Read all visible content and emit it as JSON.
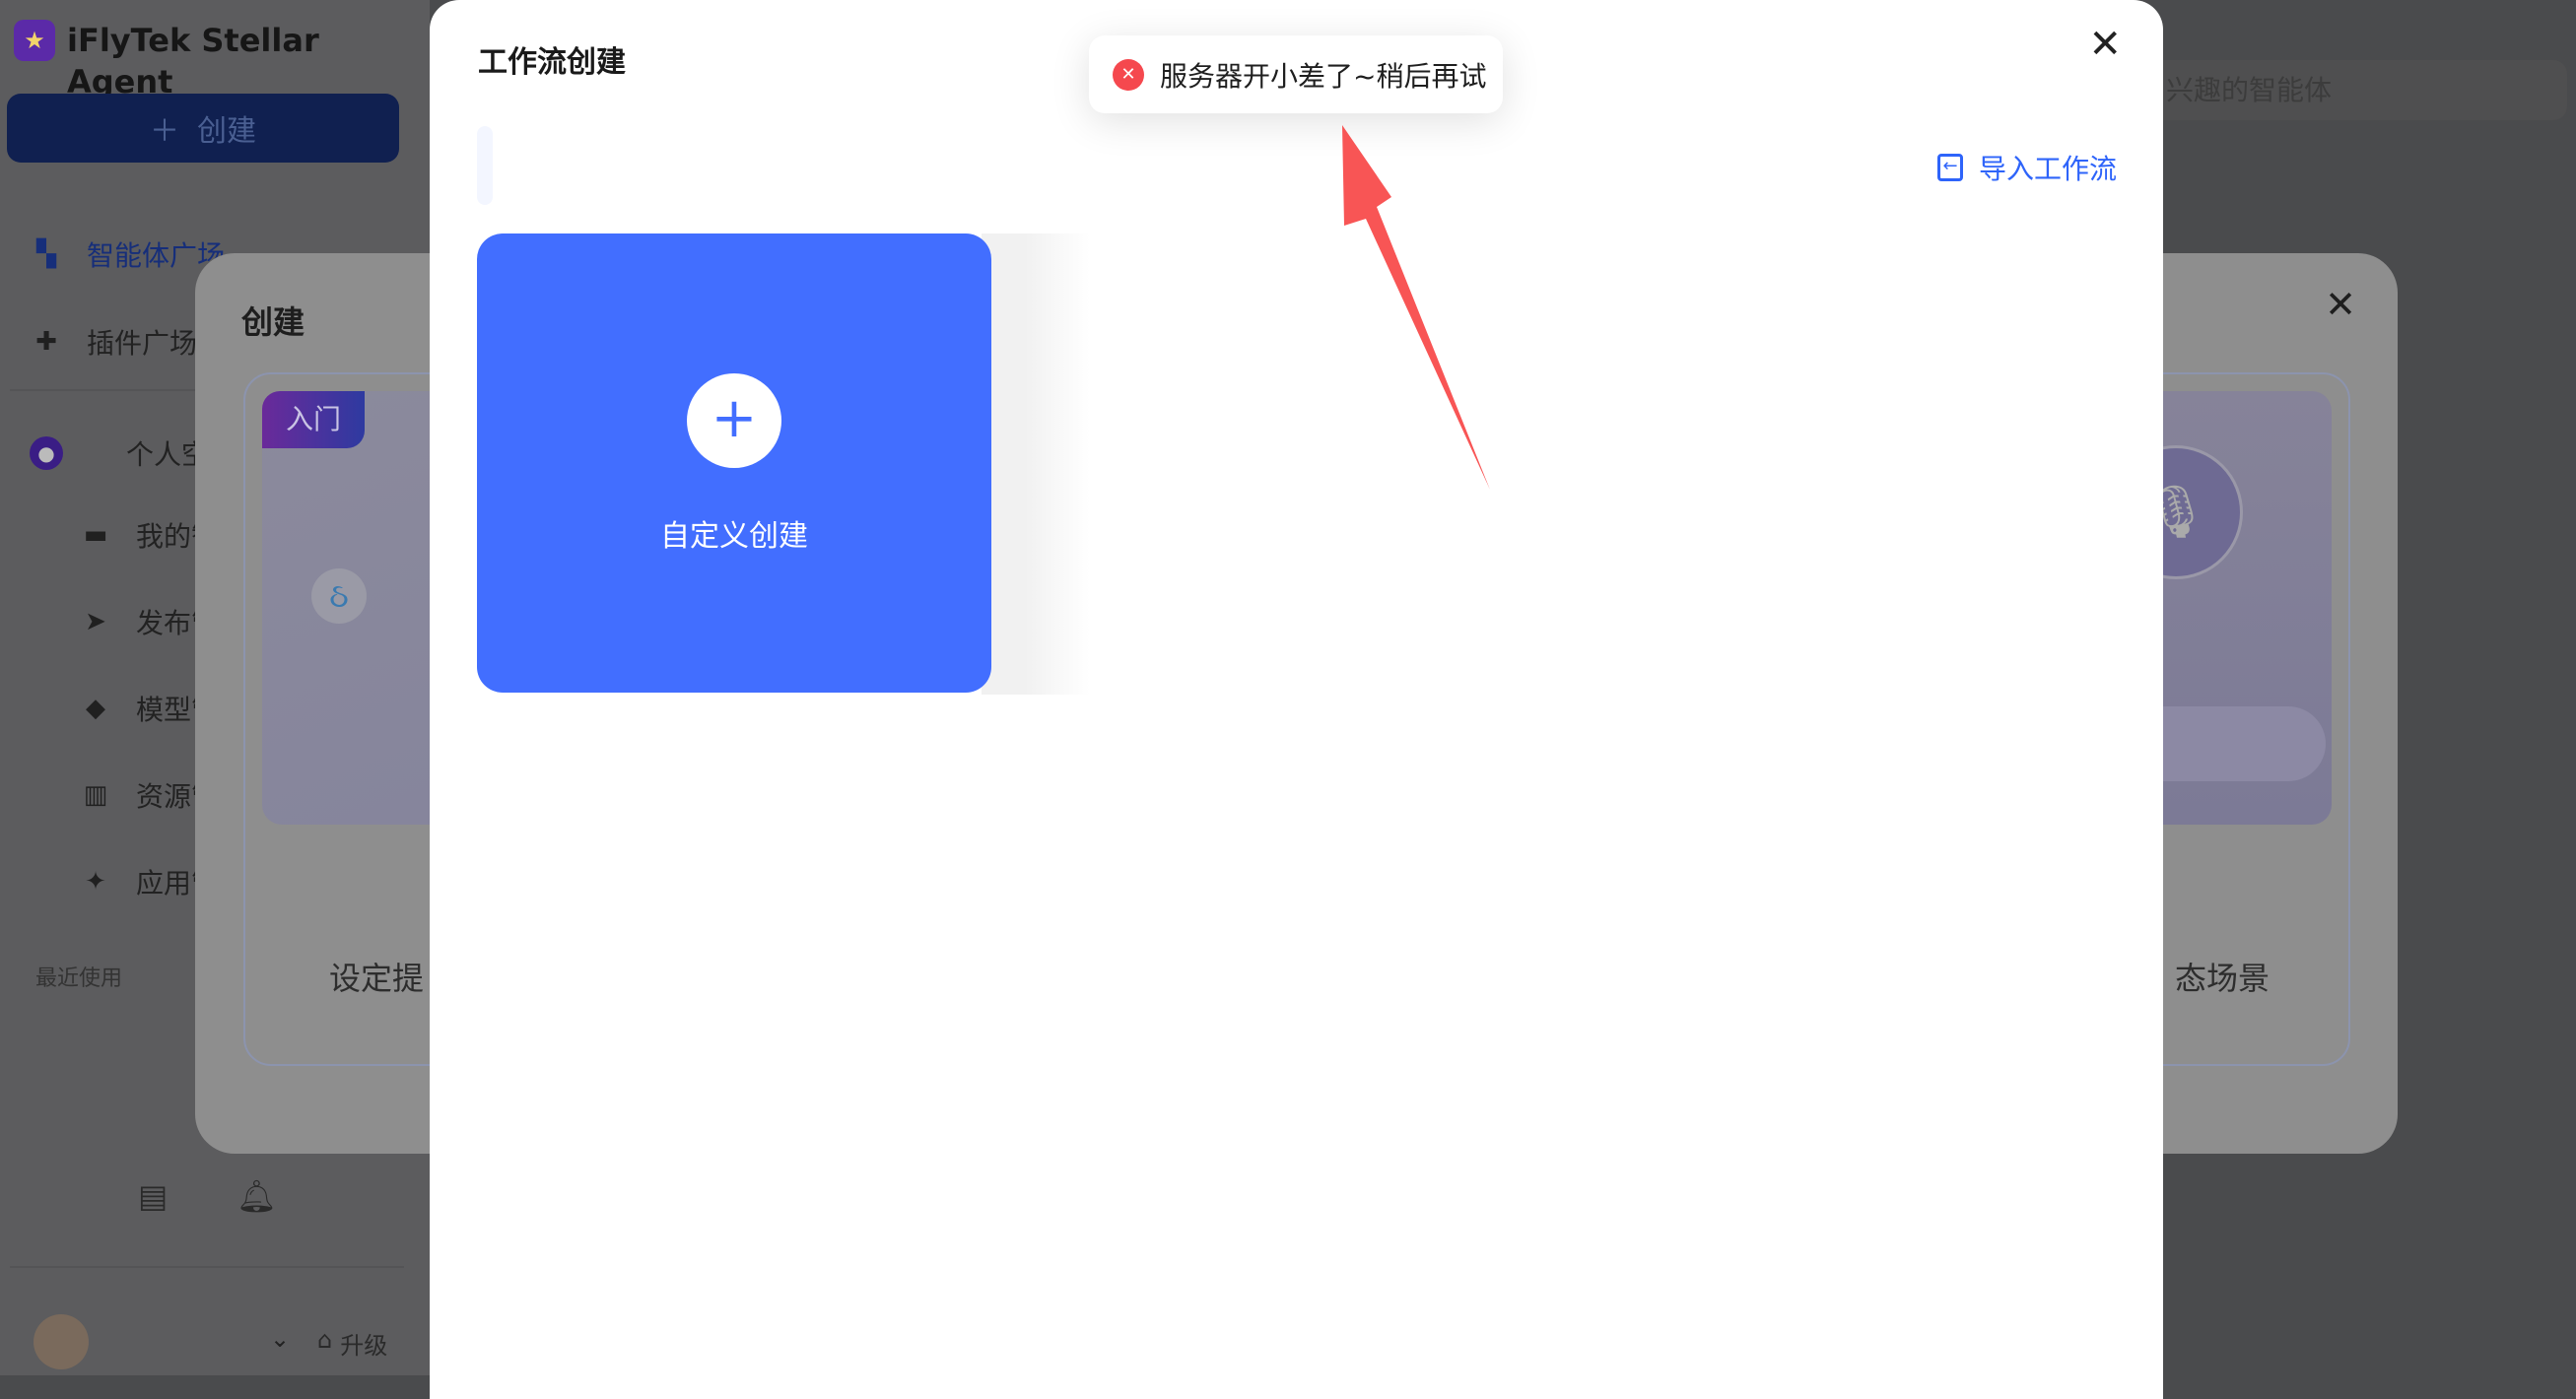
{
  "app": {
    "name": "iFlyTek Stellar Agent",
    "create_label": "创建"
  },
  "sidebar": {
    "items": [
      {
        "label": "智能体广场",
        "icon": "grid-icon"
      },
      {
        "label": "插件广场",
        "icon": "puzzle-icon"
      },
      {
        "label": "个人空间",
        "icon": "user-icon"
      },
      {
        "label": "我的智能体",
        "icon": "folder-icon"
      },
      {
        "label": "发布管理",
        "icon": "send-icon"
      },
      {
        "label": "模型管理",
        "icon": "cube-icon"
      },
      {
        "label": "资源管理",
        "icon": "book-icon"
      },
      {
        "label": "应用管理",
        "icon": "sparkle-icon"
      }
    ],
    "recent_label": "最近使用",
    "upgrade_label": "升级"
  },
  "search": {
    "placeholder": "兴趣的智能体"
  },
  "bg_modal": {
    "title": "创建",
    "badge": "入门",
    "left_text": "设定提",
    "right_text": "态场景"
  },
  "workflow_modal": {
    "title": "工作流创建",
    "import_label": "导入工作流",
    "custom_create_label": "自定义创建"
  },
  "toast": {
    "message": "服务器开小差了~稍后再试",
    "type": "error",
    "color": "#f5484e"
  },
  "colors": {
    "accent": "#426eff",
    "link": "#2e64fa",
    "annotation_arrow": "#f85555"
  }
}
